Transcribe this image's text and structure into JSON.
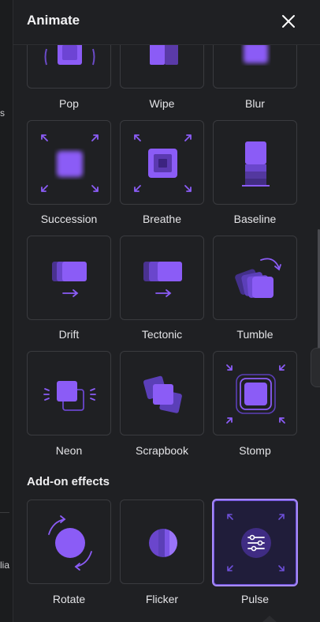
{
  "left_fragments": {
    "frag1": "s",
    "frag2": "lia"
  },
  "header": {
    "title": "Animate",
    "close_icon": "close-icon"
  },
  "effects": [
    {
      "label": "Pop",
      "icon": "pop-icon"
    },
    {
      "label": "Wipe",
      "icon": "wipe-icon"
    },
    {
      "label": "Blur",
      "icon": "blur-icon"
    },
    {
      "label": "Succession",
      "icon": "succession-icon"
    },
    {
      "label": "Breathe",
      "icon": "breathe-icon"
    },
    {
      "label": "Baseline",
      "icon": "baseline-icon"
    },
    {
      "label": "Drift",
      "icon": "drift-icon"
    },
    {
      "label": "Tectonic",
      "icon": "tectonic-icon"
    },
    {
      "label": "Tumble",
      "icon": "tumble-icon"
    },
    {
      "label": "Neon",
      "icon": "neon-icon"
    },
    {
      "label": "Scrapbook",
      "icon": "scrapbook-icon"
    },
    {
      "label": "Stomp",
      "icon": "stomp-icon"
    }
  ],
  "addons": {
    "title": "Add-on effects",
    "items": [
      {
        "label": "Rotate",
        "icon": "rotate-icon",
        "selected": false
      },
      {
        "label": "Flicker",
        "icon": "flicker-icon",
        "selected": false
      },
      {
        "label": "Pulse",
        "icon": "pulse-icon",
        "selected": true
      }
    ]
  },
  "colors": {
    "background": "#1f2023",
    "accent": "#8b5cf6",
    "accent_light": "#a78bfa",
    "tile_border": "#3a3b3f"
  }
}
